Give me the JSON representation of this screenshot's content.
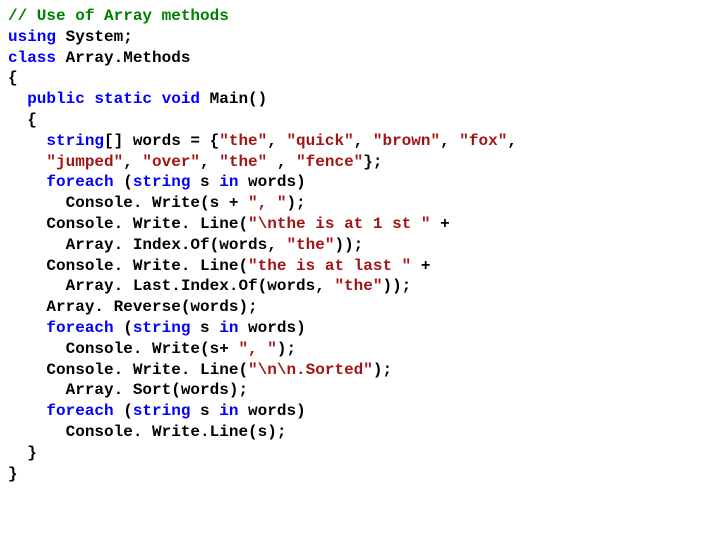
{
  "code": {
    "comment": "// Use of Array methods",
    "l1_kw": "using",
    "l1_rest": " System;",
    "l2_kw": "class",
    "l2_rest": " Array.Methods",
    "l3": "{",
    "l4_sp": "  ",
    "l4_kw": "public static void",
    "l4_rest": " Main()",
    "l5": "  {",
    "l6a": "    ",
    "l6_kw": "string",
    "l6b": "[] words = {",
    "l6_s1": "\"the\"",
    "l6_c1": ", ",
    "l6_s2": "\"quick\"",
    "l6_c2": ", ",
    "l6_s3": "\"brown\"",
    "l6_c3": ", ",
    "l6_s4": "\"fox\"",
    "l6_c4": ",",
    "l7a": "    ",
    "l7_s1": "\"jumped\"",
    "l7_c1": ", ",
    "l7_s2": "\"over\"",
    "l7_c2": ", ",
    "l7_s3": "\"the\"",
    "l7_c3": " , ",
    "l7_s4": "\"fence\"",
    "l7_c4": "};",
    "l8a": "    ",
    "l8_kw": "foreach",
    "l8b": " (",
    "l8_kw2": "string",
    "l8c": " s ",
    "l8_kw3": "in",
    "l8d": " words)",
    "l9a": "      Console. Write(s + ",
    "l9_s": "\", \"",
    "l9b": ");",
    "l10a": "    Console. Write. Line(",
    "l10_s": "\"\\nthe is at 1 st \"",
    "l10b": " +",
    "l11a": "      Array. Index.Of(words, ",
    "l11_s": "\"the\"",
    "l11b": "));",
    "l12a": "    Console. Write. Line(",
    "l12_s": "\"the is at last \"",
    "l12b": " +",
    "l13a": "      Array. Last.Index.Of(words, ",
    "l13_s": "\"the\"",
    "l13b": "));",
    "l14": "    Array. Reverse(words);",
    "l15a": "    ",
    "l15_kw": "foreach",
    "l15b": " (",
    "l15_kw2": "string",
    "l15c": " s ",
    "l15_kw3": "in",
    "l15d": " words)",
    "l16a": "      Console. Write(s+ ",
    "l16_s": "\", \"",
    "l16b": ");",
    "l17a": "    Console. Write. Line(",
    "l17_s": "\"\\n\\n.Sorted\"",
    "l17b": ");",
    "l18": "      Array. Sort(words);",
    "l19a": "    ",
    "l19_kw": "foreach",
    "l19b": " (",
    "l19_kw2": "string",
    "l19c": " s ",
    "l19_kw3": "in",
    "l19d": " words)",
    "l20": "      Console. Write.Line(s);",
    "l21": "  }",
    "l22": "}"
  }
}
